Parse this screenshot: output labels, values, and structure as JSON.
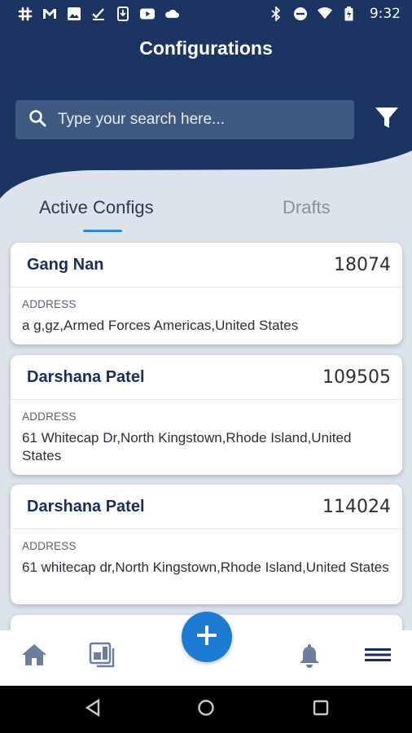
{
  "status_bar": {
    "time": "9:32",
    "left_icons": [
      "slack-icon",
      "gmail-icon",
      "image-icon",
      "checkmark-icon",
      "phone-download-icon",
      "youtube-icon",
      "cloud-icon"
    ],
    "right_icons": [
      "bluetooth-icon",
      "do-not-disturb-icon",
      "wifi-icon",
      "battery-icon"
    ]
  },
  "header": {
    "title": "Configurations",
    "search_placeholder": "Type your search here...",
    "filter_icon": "filter-icon"
  },
  "tabs": [
    {
      "label": "Active Configs",
      "active": true
    },
    {
      "label": "Drafts",
      "active": false
    }
  ],
  "configs": [
    {
      "name": "Gang Nan",
      "id": "18074",
      "address_label": "ADDRESS",
      "address": "a g,gz,Armed Forces Americas,United States"
    },
    {
      "name": "Darshana Patel",
      "id": "109505",
      "address_label": "ADDRESS",
      "address": "61 Whitecap Dr,North Kingstown,Rhode Island,United States"
    },
    {
      "name": "Darshana Patel",
      "id": "114024",
      "address_label": "ADDRESS",
      "address": "61 whitecap dr,North Kingstown,Rhode Island,United States"
    }
  ],
  "bottom_nav": {
    "items": [
      "home-icon",
      "dashboard-icon",
      "add-icon",
      "notifications-icon",
      "menu-icon"
    ]
  },
  "colors": {
    "header": "#1b3461",
    "accent": "#1d7bd1",
    "nav_icon": "#6a7f9c",
    "name_text": "#1b2d5a"
  }
}
